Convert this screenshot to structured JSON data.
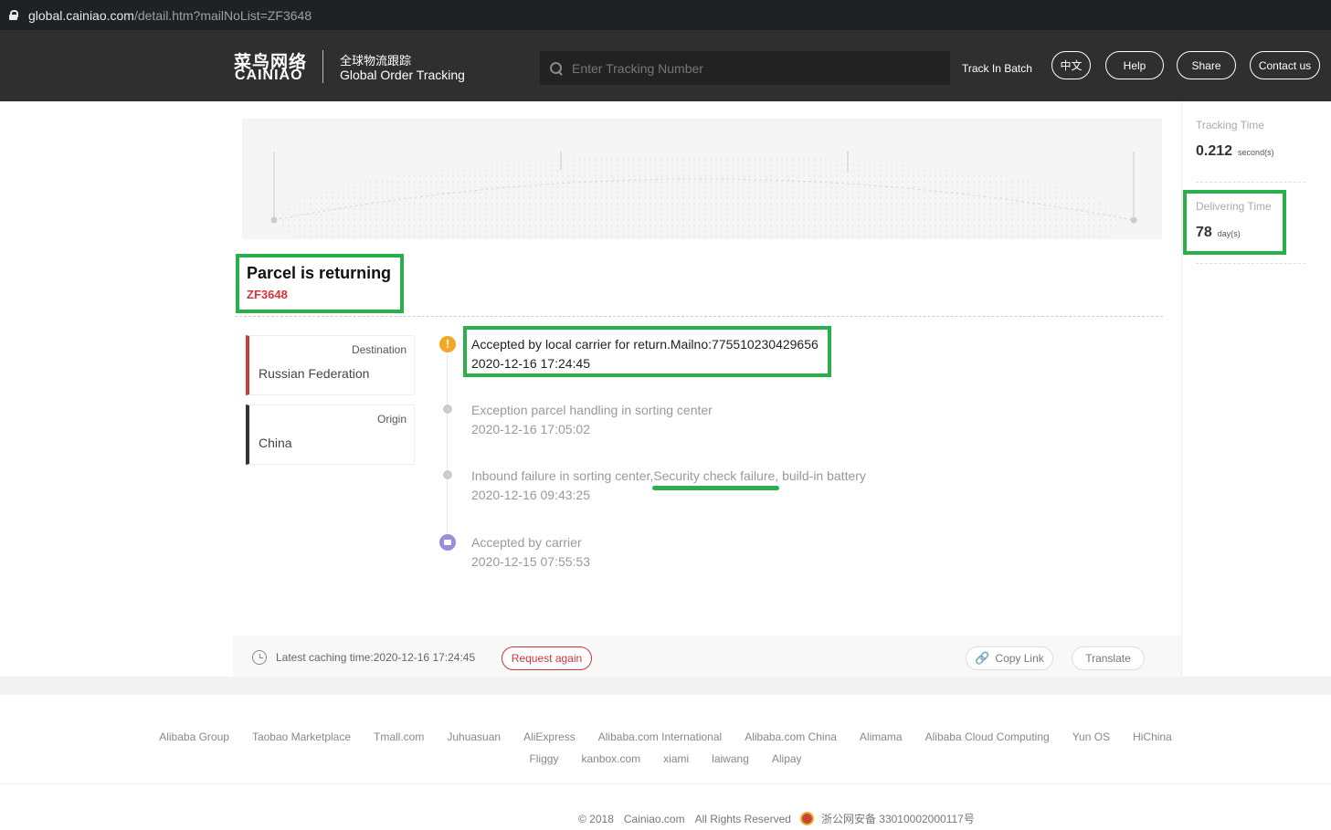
{
  "browser": {
    "url_host": "global.cainiao.com",
    "url_path": "/detail.htm?mailNoList=ZF3648"
  },
  "header": {
    "brand_cn": "菜鸟网络",
    "brand_en": "CAINIAO",
    "subtitle_cn": "全球物流跟踪",
    "subtitle_en": "Global Order Tracking",
    "search_placeholder": "Enter Tracking Number",
    "track_batch": "Track In Batch",
    "lang_button": "中文",
    "help_button": "Help",
    "share_button": "Share",
    "contact_button": "Contact us"
  },
  "stats": {
    "tracking_time_label": "Tracking Time",
    "tracking_time_value": "0.212",
    "tracking_time_unit": "second(s)",
    "delivering_time_label": "Delivering Time",
    "delivering_time_value": "78",
    "delivering_time_unit": "day(s)"
  },
  "parcel": {
    "status": "Parcel is returning",
    "number": "ZF3648"
  },
  "route": {
    "destination_label": "Destination",
    "destination_value": "Russian Federation",
    "origin_label": "Origin",
    "origin_value": "China"
  },
  "events": [
    {
      "text": "Accepted by local carrier for return.Mailno:775510230429656",
      "time": "2020-12-16 17:24:45"
    },
    {
      "text": "Exception parcel handling in sorting center",
      "time": "2020-12-16 17:05:02"
    },
    {
      "text": "Inbound failure in sorting center,Security check failure, build-in battery",
      "time": "2020-12-16 09:43:25"
    },
    {
      "text": "Accepted by carrier",
      "time": "2020-12-15 07:55:53"
    }
  ],
  "footer_bar": {
    "cache_text": "Latest caching time:2020-12-16 17:24:45",
    "request_again": "Request again",
    "copy_link": "Copy Link",
    "translate": "Translate"
  },
  "footer_links_row1": [
    "Alibaba Group",
    "Taobao Marketplace",
    "Tmall.com",
    "Juhuasuan",
    "AliExpress",
    "Alibaba.com International",
    "Alibaba.com China",
    "Alimama",
    "Alibaba Cloud Computing",
    "Yun OS",
    "HiChina"
  ],
  "footer_links_row2": [
    "Fliggy",
    "kanbox.com",
    "xiami",
    "laiwang",
    "Alipay"
  ],
  "copyright": {
    "year": "© 2018",
    "site": "Cainiao.com",
    "rights": "All Rights Reserved",
    "icp": "浙公网安备 33010002000117号"
  },
  "colors": {
    "highlight": "#2ab04b",
    "topbar": "#2f2f2f",
    "accent_red": "#d2343a",
    "warn": "#f5a623"
  }
}
